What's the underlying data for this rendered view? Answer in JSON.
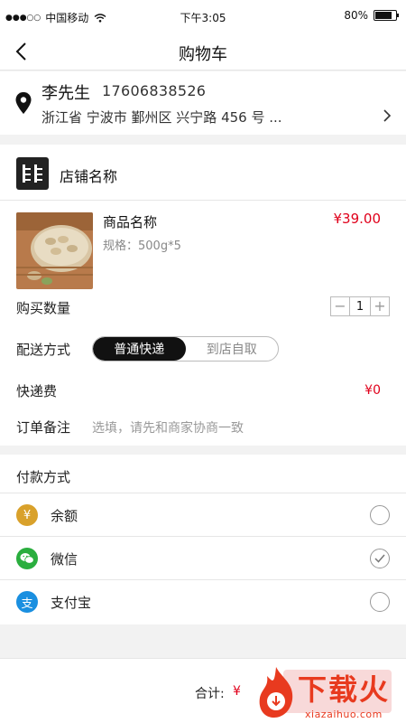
{
  "status_bar": {
    "signal": "●●●○○",
    "carrier": "中国移动",
    "time": "下午3:05",
    "battery": "80%",
    "battery_level": 0.8
  },
  "nav": {
    "title": "购物车",
    "back_icon": "chevron-left-icon"
  },
  "address": {
    "name": "李先生",
    "phone": "17606838526",
    "full": "浙江省  宁波市  鄞州区  兴宁路 456 号 ..."
  },
  "shop": {
    "name": "店铺名称",
    "logo_text": "非"
  },
  "product": {
    "name": "商品名称",
    "spec": "规格：500g*5",
    "price": "¥39.00"
  },
  "quantity": {
    "label": "购买数量",
    "value": "1",
    "minus": "−",
    "plus": "+"
  },
  "delivery": {
    "label": "配送方式",
    "options": [
      "普通快递",
      "到店自取"
    ],
    "selected": "普通快递"
  },
  "fee": {
    "label": "快递费",
    "value": "¥0"
  },
  "remark": {
    "label": "订单备注",
    "placeholder": "选填，请先和商家协商一致"
  },
  "payment": {
    "title": "付款方式",
    "methods": [
      {
        "label": "余额",
        "icon": "yen-icon",
        "color": "#d9a12b",
        "selected": false
      },
      {
        "label": "微信",
        "icon": "wechat-icon",
        "color": "#2aae3e",
        "selected": true
      },
      {
        "label": "支付宝",
        "icon": "alipay-icon",
        "color": "#1a8fe0",
        "selected": false
      }
    ]
  },
  "footer": {
    "total_label": "合计:",
    "total_value": "¥"
  },
  "watermark": {
    "text": "下载火",
    "domain": "xiazaihuo.com"
  },
  "colors": {
    "price_red": "#e0001b",
    "accent_dark": "#111111"
  }
}
